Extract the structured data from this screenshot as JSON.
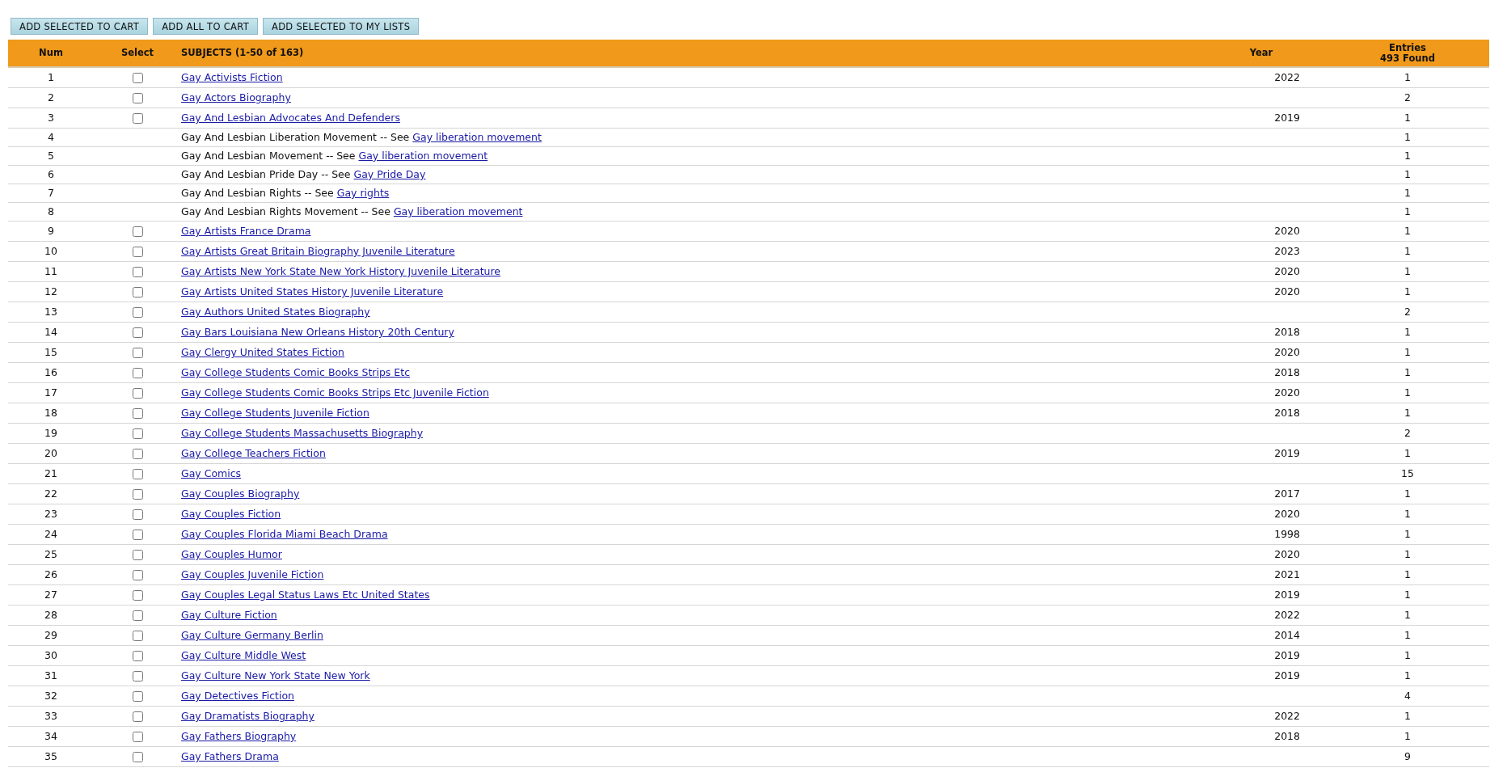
{
  "buttons": [
    "ADD SELECTED TO CART",
    "ADD ALL TO CART",
    "ADD SELECTED TO MY LISTS"
  ],
  "table": {
    "columns": [
      {
        "label": "Num"
      },
      {
        "label": "Select"
      },
      {
        "label": "SUBJECTS (1-50 of 163)"
      },
      {
        "label": "Year"
      },
      {
        "label": "Entries",
        "sublabel": "493 Found"
      }
    ],
    "rows": [
      {
        "num": "1",
        "kind": "subject",
        "checked": false,
        "subject": "Gay Activists Fiction",
        "year": "2022",
        "entries": "1"
      },
      {
        "num": "2",
        "kind": "subject",
        "checked": false,
        "subject": "Gay Actors Biography",
        "entries": "2"
      },
      {
        "num": "3",
        "kind": "subject",
        "checked": false,
        "subject": "Gay And Lesbian Advocates And Defenders",
        "year": "2019",
        "entries": "1"
      },
      {
        "num": "4",
        "kind": "see",
        "subject": "Gay And Lesbian Liberation Movement -- See",
        "link": "Gay liberation movement",
        "entries": "1"
      },
      {
        "num": "5",
        "kind": "see",
        "subject": "Gay And Lesbian Movement -- See",
        "link": "Gay liberation movement",
        "entries": "1"
      },
      {
        "num": "6",
        "kind": "see",
        "subject": "Gay And Lesbian Pride Day -- See",
        "link": "Gay Pride Day",
        "entries": "1"
      },
      {
        "num": "7",
        "kind": "see",
        "subject": "Gay And Lesbian Rights -- See",
        "link": "Gay rights",
        "entries": "1"
      },
      {
        "num": "8",
        "kind": "see",
        "subject": "Gay And Lesbian Rights Movement -- See",
        "link": "Gay liberation movement",
        "entries": "1"
      },
      {
        "num": "9",
        "kind": "subject",
        "checked": false,
        "subject": "Gay Artists France Drama",
        "year": "2020",
        "entries": "1"
      },
      {
        "num": "10",
        "kind": "subject",
        "checked": false,
        "subject": "Gay Artists Great Britain Biography Juvenile Literature",
        "year": "2023",
        "entries": "1"
      },
      {
        "num": "11",
        "kind": "subject",
        "checked": false,
        "subject": "Gay Artists New York State New York History Juvenile Literature",
        "year": "2020",
        "entries": "1"
      },
      {
        "num": "12",
        "kind": "subject",
        "checked": false,
        "subject": "Gay Artists United States History Juvenile Literature",
        "year": "2020",
        "entries": "1"
      },
      {
        "num": "13",
        "kind": "subject",
        "checked": false,
        "subject": "Gay Authors United States Biography",
        "entries": "2"
      },
      {
        "num": "14",
        "kind": "subject",
        "checked": false,
        "subject": "Gay Bars Louisiana New Orleans History 20th Century",
        "year": "2018",
        "entries": "1"
      },
      {
        "num": "15",
        "kind": "subject",
        "checked": false,
        "subject": "Gay Clergy United States Fiction",
        "year": "2020",
        "entries": "1"
      },
      {
        "num": "16",
        "kind": "subject",
        "checked": false,
        "subject": "Gay College Students Comic Books Strips Etc",
        "year": "2018",
        "entries": "1"
      },
      {
        "num": "17",
        "kind": "subject",
        "checked": false,
        "subject": "Gay College Students Comic Books Strips Etc Juvenile Fiction",
        "year": "2020",
        "entries": "1"
      },
      {
        "num": "18",
        "kind": "subject",
        "checked": false,
        "subject": "Gay College Students Juvenile Fiction",
        "year": "2018",
        "entries": "1"
      },
      {
        "num": "19",
        "kind": "subject",
        "checked": false,
        "subject": "Gay College Students Massachusetts Biography",
        "entries": "2"
      },
      {
        "num": "20",
        "kind": "subject",
        "checked": false,
        "subject": "Gay College Teachers Fiction",
        "year": "2019",
        "entries": "1"
      },
      {
        "num": "21",
        "kind": "subject",
        "checked": false,
        "subject": "Gay Comics",
        "entries": "15"
      },
      {
        "num": "22",
        "kind": "subject",
        "checked": false,
        "subject": "Gay Couples Biography",
        "year": "2017",
        "entries": "1"
      },
      {
        "num": "23",
        "kind": "subject",
        "checked": false,
        "subject": "Gay Couples Fiction",
        "year": "2020",
        "entries": "1"
      },
      {
        "num": "24",
        "kind": "subject",
        "checked": false,
        "subject": "Gay Couples Florida Miami Beach Drama",
        "year": "1998",
        "entries": "1"
      },
      {
        "num": "25",
        "kind": "subject",
        "checked": false,
        "subject": "Gay Couples Humor",
        "year": "2020",
        "entries": "1"
      },
      {
        "num": "26",
        "kind": "subject",
        "checked": false,
        "subject": "Gay Couples Juvenile Fiction",
        "year": "2021",
        "entries": "1"
      },
      {
        "num": "27",
        "kind": "subject",
        "checked": false,
        "subject": "Gay Couples Legal Status Laws Etc United States",
        "year": "2019",
        "entries": "1"
      },
      {
        "num": "28",
        "kind": "subject",
        "checked": false,
        "subject": "Gay Culture Fiction",
        "year": "2022",
        "entries": "1"
      },
      {
        "num": "29",
        "kind": "subject",
        "checked": false,
        "subject": "Gay Culture Germany Berlin",
        "year": "2014",
        "entries": "1"
      },
      {
        "num": "30",
        "kind": "subject",
        "checked": false,
        "subject": "Gay Culture Middle West",
        "year": "2019",
        "entries": "1"
      },
      {
        "num": "31",
        "kind": "subject",
        "checked": false,
        "subject": "Gay Culture New York State New York",
        "year": "2019",
        "entries": "1"
      },
      {
        "num": "32",
        "kind": "subject",
        "checked": false,
        "subject": "Gay Detectives Fiction",
        "entries": "4"
      },
      {
        "num": "33",
        "kind": "subject",
        "checked": false,
        "subject": "Gay Dramatists Biography",
        "year": "2022",
        "entries": "1"
      },
      {
        "num": "34",
        "kind": "subject",
        "checked": false,
        "subject": "Gay Fathers Biography",
        "year": "2018",
        "entries": "1"
      },
      {
        "num": "35",
        "kind": "subject",
        "checked": false,
        "subject": "Gay Fathers Drama",
        "entries": "9"
      }
    ]
  }
}
